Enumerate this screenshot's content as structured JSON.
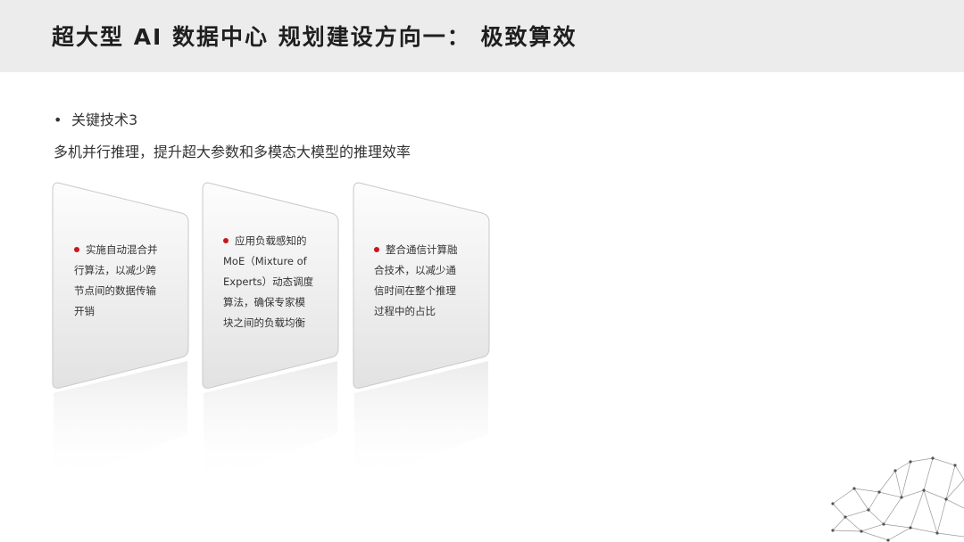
{
  "header": {
    "title": "超大型 AI 数据中心 规划建设方向一： 极致算效"
  },
  "section": {
    "bullet_symbol": "•",
    "heading": "关键技术3",
    "subtitle": "多机并行推理，提升超大参数和多模态大模型的推理效率"
  },
  "cards": [
    {
      "lines": [
        "实施自动混合并",
        "行算法，以减少跨",
        "节点间的数据传输",
        "开销"
      ]
    },
    {
      "lines": [
        "应用负载感知的",
        "MoE（Mixture of",
        "Experts）动态调度",
        "算法，确保专家模",
        "块之间的负载均衡"
      ]
    },
    {
      "lines": [
        "整合通信计算融",
        "合技术，以减少通",
        "信时间在整个推理",
        "过程中的占比"
      ]
    }
  ],
  "colors": {
    "accent": "#c8161d",
    "header_bg": "#ececec"
  }
}
